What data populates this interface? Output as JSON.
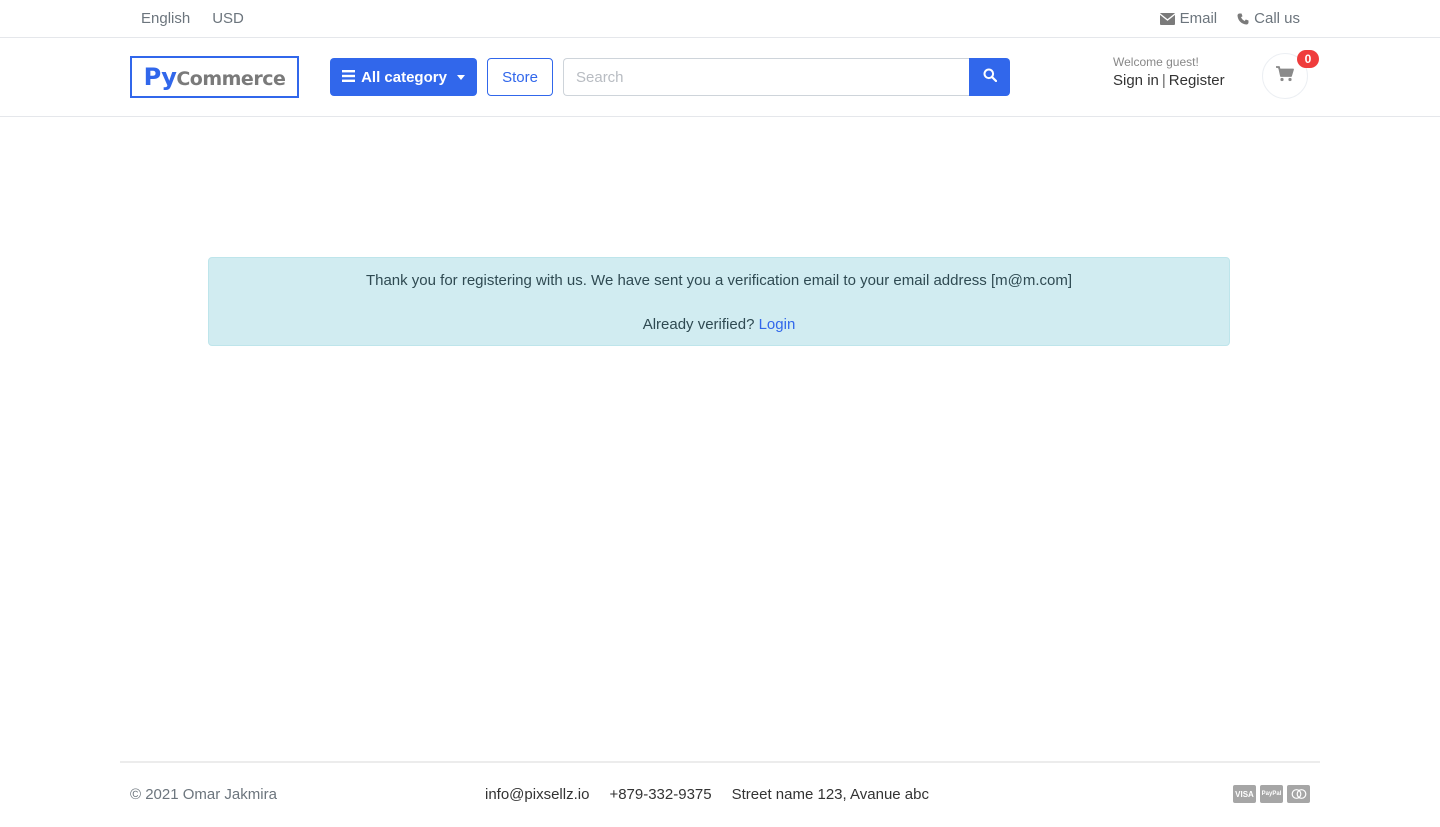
{
  "topbar": {
    "language": "English",
    "currency": "USD",
    "email_label": "Email",
    "call_label": "Call us"
  },
  "header": {
    "logo_py": "Py",
    "logo_rest": "Commerce",
    "category_button": "All category",
    "store_button": "Store",
    "search_placeholder": "Search",
    "welcome_text": "Welcome guest!",
    "sign_in": "Sign in",
    "separator": "|",
    "register": "Register",
    "cart_count": "0"
  },
  "alert": {
    "message": "Thank you for registering with us. We have sent you a verification email to your email address [m@m.com]",
    "verified_question": "Already verified?",
    "login_link": "Login"
  },
  "footer": {
    "copyright": "© 2021 Omar Jakmira",
    "email": "info@pixsellz.io",
    "phone": "+879-332-9375",
    "address": "Street name 123, Avanue abc",
    "payments": [
      "VISA",
      "PayPal",
      "MC"
    ]
  },
  "colors": {
    "primary": "#3167eb",
    "alert_bg": "#d1ecf1",
    "badge": "#ef3c3c"
  }
}
